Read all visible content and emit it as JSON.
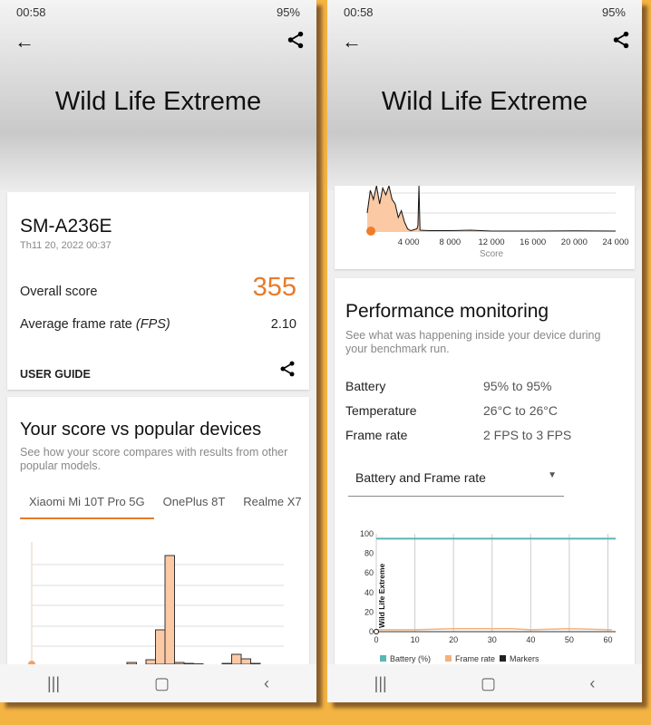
{
  "status": {
    "time": "00:58",
    "battery": "95%"
  },
  "header": {
    "title": "Wild Life Extreme"
  },
  "result": {
    "device": "SM-A236E",
    "date": "Th11 20, 2022 00:37",
    "overall_label": "Overall score",
    "overall_value": "355",
    "fps_label": "Average frame rate",
    "fps_unit": "(FPS)",
    "fps_value": "2.10",
    "user_guide": "USER GUIDE"
  },
  "compare": {
    "title": "Your score vs popular devices",
    "desc": "See how your score compares with results from other popular models.",
    "tabs": [
      "Xiaomi Mi 10T Pro 5G",
      "OnePlus 8T",
      "Realme X7"
    ],
    "active_tab": 0
  },
  "perf": {
    "title": "Performance monitoring",
    "desc": "See what was happening inside your device during your benchmark run.",
    "rows": [
      {
        "label": "Battery",
        "value": "95% to 95%"
      },
      {
        "label": "Temperature",
        "value": "26°C to 26°C"
      },
      {
        "label": "Frame rate",
        "value": "2 FPS to 3 FPS"
      }
    ],
    "dropdown": "Battery and Frame rate"
  },
  "colors": {
    "accent": "#e87b2b",
    "battery": "#5bb5b5",
    "framerate": "#f4b07a",
    "markers": "#222222",
    "background": "#f4b443"
  },
  "chart_data": [
    {
      "type": "bar",
      "title": "",
      "note": "histogram of popular device scores, relative heights",
      "values": [
        0,
        0,
        0,
        0,
        0,
        0,
        0,
        0,
        0,
        0,
        2,
        0,
        5,
        38,
        120,
        2,
        1,
        0.5,
        0,
        0,
        1,
        11,
        6,
        1
      ],
      "your_score": 355
    },
    {
      "type": "area",
      "xlabel": "Score",
      "xticks": [
        "4 000",
        "8 000",
        "12 000",
        "16 000",
        "20 000",
        "24 000"
      ],
      "xlim": [
        0,
        24000
      ],
      "x": [
        0,
        300,
        600,
        900,
        1200,
        1500,
        1800,
        2100,
        2400,
        2700,
        3000,
        3300,
        3600,
        3900,
        4200,
        4500,
        4800,
        4900,
        5000,
        5100,
        6000,
        8000,
        10000,
        12000,
        16000,
        20000,
        24000
      ],
      "values": [
        40,
        90,
        70,
        100,
        60,
        95,
        80,
        100,
        70,
        60,
        30,
        45,
        20,
        5,
        1,
        3,
        5,
        12,
        100,
        2,
        1,
        1,
        2,
        0,
        0,
        0.5,
        0
      ],
      "your_score": 355
    },
    {
      "type": "line",
      "xlim": [
        0,
        62
      ],
      "ylim": [
        0,
        100
      ],
      "xticks": [
        "0",
        "10",
        "20",
        "30",
        "40",
        "50",
        "60"
      ],
      "yticks": [
        "0",
        "20",
        "40",
        "60",
        "80",
        "100"
      ],
      "marker_label": "Wild Life Extreme",
      "legend": [
        "Battery (%)",
        "Frame rate",
        "Markers"
      ],
      "legend_position": "bottom",
      "series": [
        {
          "name": "Battery (%)",
          "x": [
            0,
            62
          ],
          "values": [
            95,
            95
          ]
        },
        {
          "name": "Frame rate",
          "x": [
            0,
            10,
            20,
            30,
            35,
            40,
            50,
            61
          ],
          "values": [
            2,
            2,
            3,
            3,
            3,
            2,
            3,
            2
          ]
        }
      ]
    }
  ]
}
